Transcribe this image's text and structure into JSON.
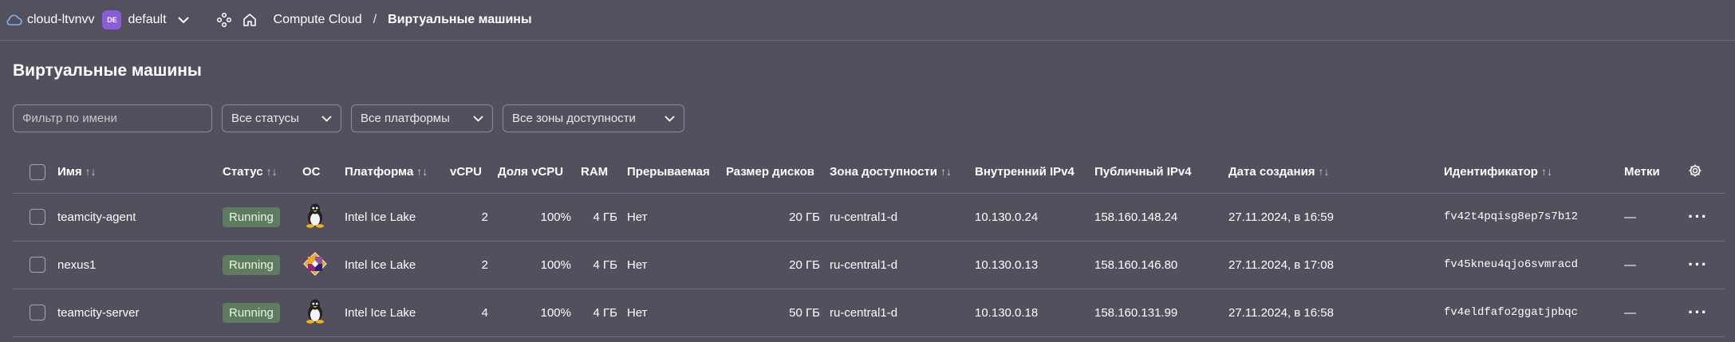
{
  "topbar": {
    "cloud_icon": "cloud-icon",
    "cloud_name": "cloud-ltvnvv",
    "folder_badge": "DE",
    "folder_name": "default",
    "breadcrumb": {
      "service": "Compute Cloud",
      "separator": "/",
      "current": "Виртуальные машины"
    }
  },
  "page": {
    "title": "Виртуальные машины"
  },
  "filters": {
    "name_placeholder": "Фильтр по имени",
    "status": "Все статусы",
    "platform": "Все платформы",
    "zone": "Все зоны доступности"
  },
  "table": {
    "columns": {
      "name": "Имя",
      "status": "Статус",
      "os": "ОС",
      "platform": "Платформа",
      "vcpu": "vCPU",
      "vcpu_share": "Доля vCPU",
      "ram": "RAM",
      "preemptible": "Прерываемая",
      "disk_size": "Размер дисков",
      "zone": "Зона доступности",
      "internal_ip": "Внутренний IPv4",
      "public_ip": "Публичный IPv4",
      "created": "Дата создания",
      "id": "Идентификатор",
      "labels": "Метки"
    },
    "sort_glyph": "↑↓",
    "rows": [
      {
        "name": "teamcity-agent",
        "status": "Running",
        "os_icon": "linux-tux-icon",
        "platform": "Intel Ice Lake",
        "vcpu": "2",
        "vcpu_share": "100%",
        "ram": "4 ГБ",
        "preemptible": "Нет",
        "disk_size": "20 ГБ",
        "zone": "ru-central1-d",
        "internal_ip": "10.130.0.24",
        "public_ip": "158.160.148.24",
        "created": "27.11.2024, в 16:59",
        "id": "fv42t4pqisg8ep7s7b12",
        "labels": "—",
        "actions": "···"
      },
      {
        "name": "nexus1",
        "status": "Running",
        "os_icon": "centos-icon",
        "platform": "Intel Ice Lake",
        "vcpu": "2",
        "vcpu_share": "100%",
        "ram": "4 ГБ",
        "preemptible": "Нет",
        "disk_size": "20 ГБ",
        "zone": "ru-central1-d",
        "internal_ip": "10.130.0.13",
        "public_ip": "158.160.146.80",
        "created": "27.11.2024, в 17:08",
        "id": "fv45kneu4qjo6svmracd",
        "labels": "—",
        "actions": "···"
      },
      {
        "name": "teamcity-server",
        "status": "Running",
        "os_icon": "linux-tux-icon",
        "platform": "Intel Ice Lake",
        "vcpu": "4",
        "vcpu_share": "100%",
        "ram": "4 ГБ",
        "preemptible": "Нет",
        "disk_size": "50 ГБ",
        "zone": "ru-central1-d",
        "internal_ip": "10.130.0.18",
        "public_ip": "158.160.131.99",
        "created": "27.11.2024, в 16:58",
        "id": "fv4eldfafo2ggatjpbqc",
        "labels": "—",
        "actions": "···"
      }
    ]
  },
  "colors": {
    "background": "#52505c",
    "status_running": "#5e7c5f",
    "folder_badge": "#8b5cd9"
  }
}
